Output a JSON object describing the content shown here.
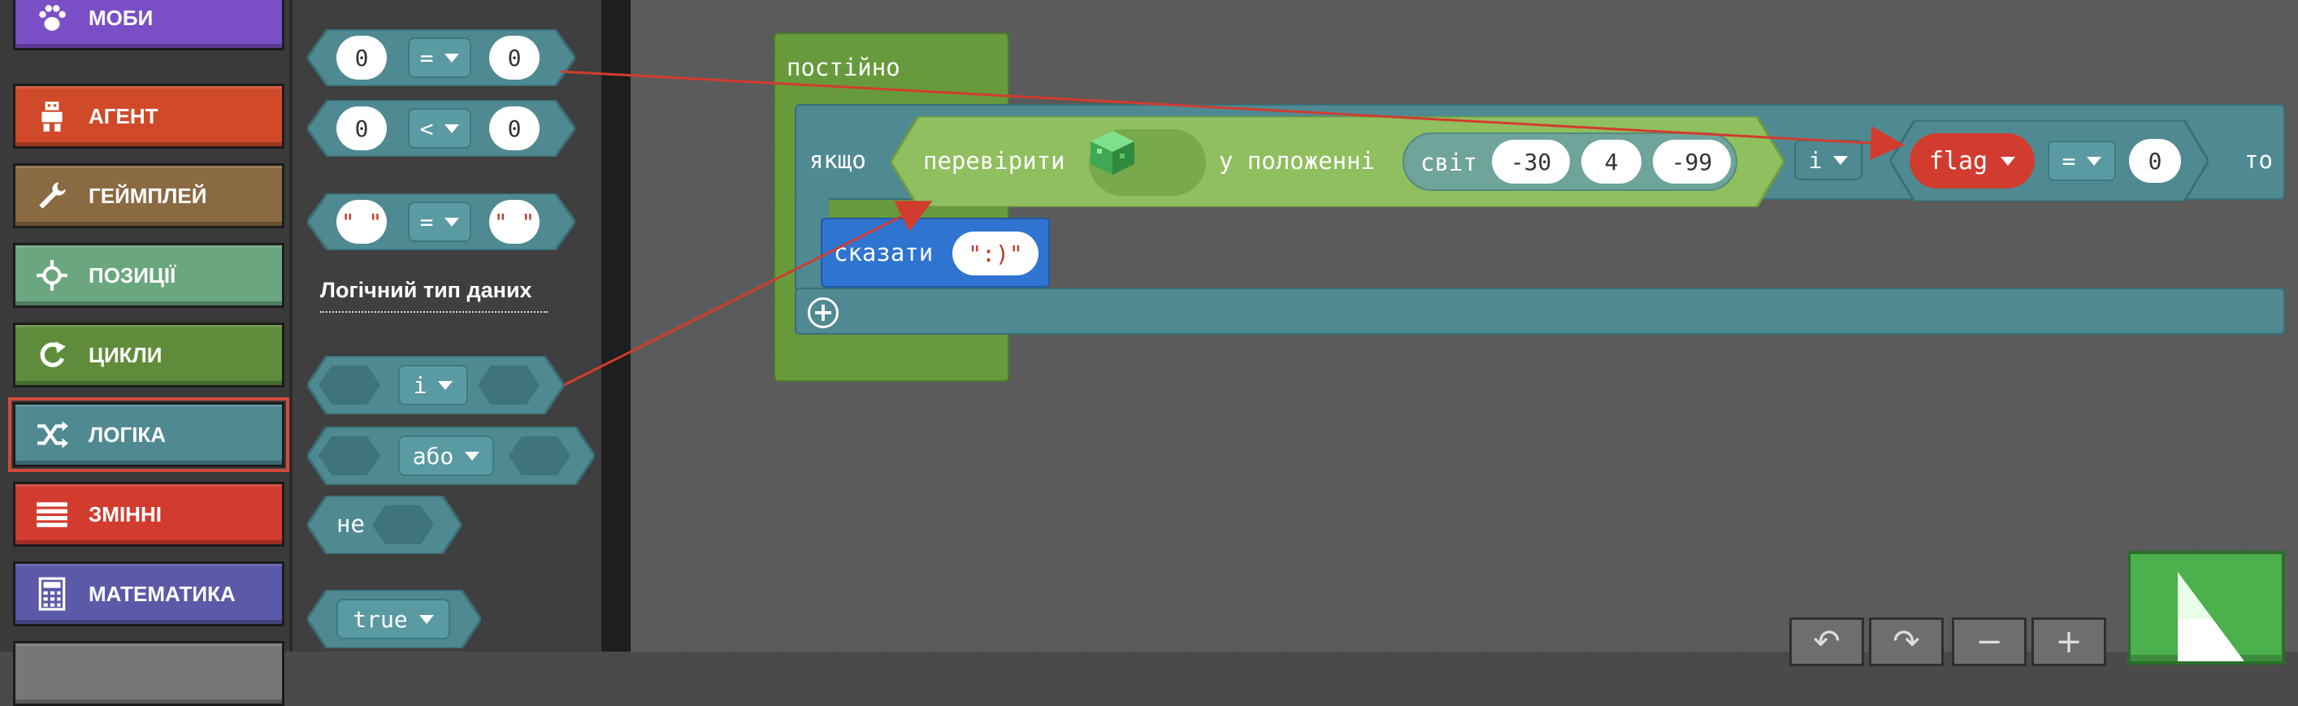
{
  "sidebar": {
    "categories": [
      {
        "label": "МОБИ",
        "color": "#7a4fc6",
        "icon": "paw-icon"
      },
      {
        "label": "АГЕНТ",
        "color": "#d04a2a",
        "icon": "agent-icon"
      },
      {
        "label": "ГЕЙМПЛЕЙ",
        "color": "#8a6a42",
        "icon": "wrench-icon"
      },
      {
        "label": "ПОЗИЦІЇ",
        "color": "#6aa67e",
        "icon": "crosshair-icon"
      },
      {
        "label": "ЦИКЛИ",
        "color": "#5f8c3a",
        "icon": "loop-icon"
      },
      {
        "label": "ЛОГІКА",
        "color": "#4f8a92",
        "icon": "shuffle-icon",
        "selected": true
      },
      {
        "label": "ЗМІННІ",
        "color": "#d13c2f",
        "icon": "list-icon"
      },
      {
        "label": "МАТЕМАТИКА",
        "color": "#5b5aa8",
        "icon": "calculator-icon"
      }
    ]
  },
  "flyout": {
    "compare_eq_num": {
      "left": "0",
      "op": "=",
      "right": "0"
    },
    "compare_lt_num": {
      "left": "0",
      "op": "<",
      "right": "0"
    },
    "compare_eq_str": {
      "left": "\" \"",
      "op": "=",
      "right": "\" \""
    },
    "section_label": "Логічний тип даних",
    "and_op": "і",
    "or_op": "або",
    "not_label": "не",
    "bool_value": "true"
  },
  "workspace": {
    "forever_label": "постійно",
    "if_label": "якщо",
    "then_label": "то",
    "check_label": "перевірити",
    "block_icon": "emerald-block-icon",
    "at_position_label": "у положенні",
    "world_label": "світ",
    "coords": {
      "x": "-30",
      "y": "4",
      "z": "-99"
    },
    "and_op": "і",
    "flag_var": "flag",
    "flag_op": "=",
    "flag_value": "0",
    "say_label": "сказати",
    "say_value": "\":)\""
  },
  "colors": {
    "logic": "#4f8a92",
    "loops": "#5f8c3a",
    "variables": "#d13c2f",
    "player": "#2f74d0",
    "positions": "#8fbf5e",
    "annotation_arrow": "#d13c2f"
  }
}
